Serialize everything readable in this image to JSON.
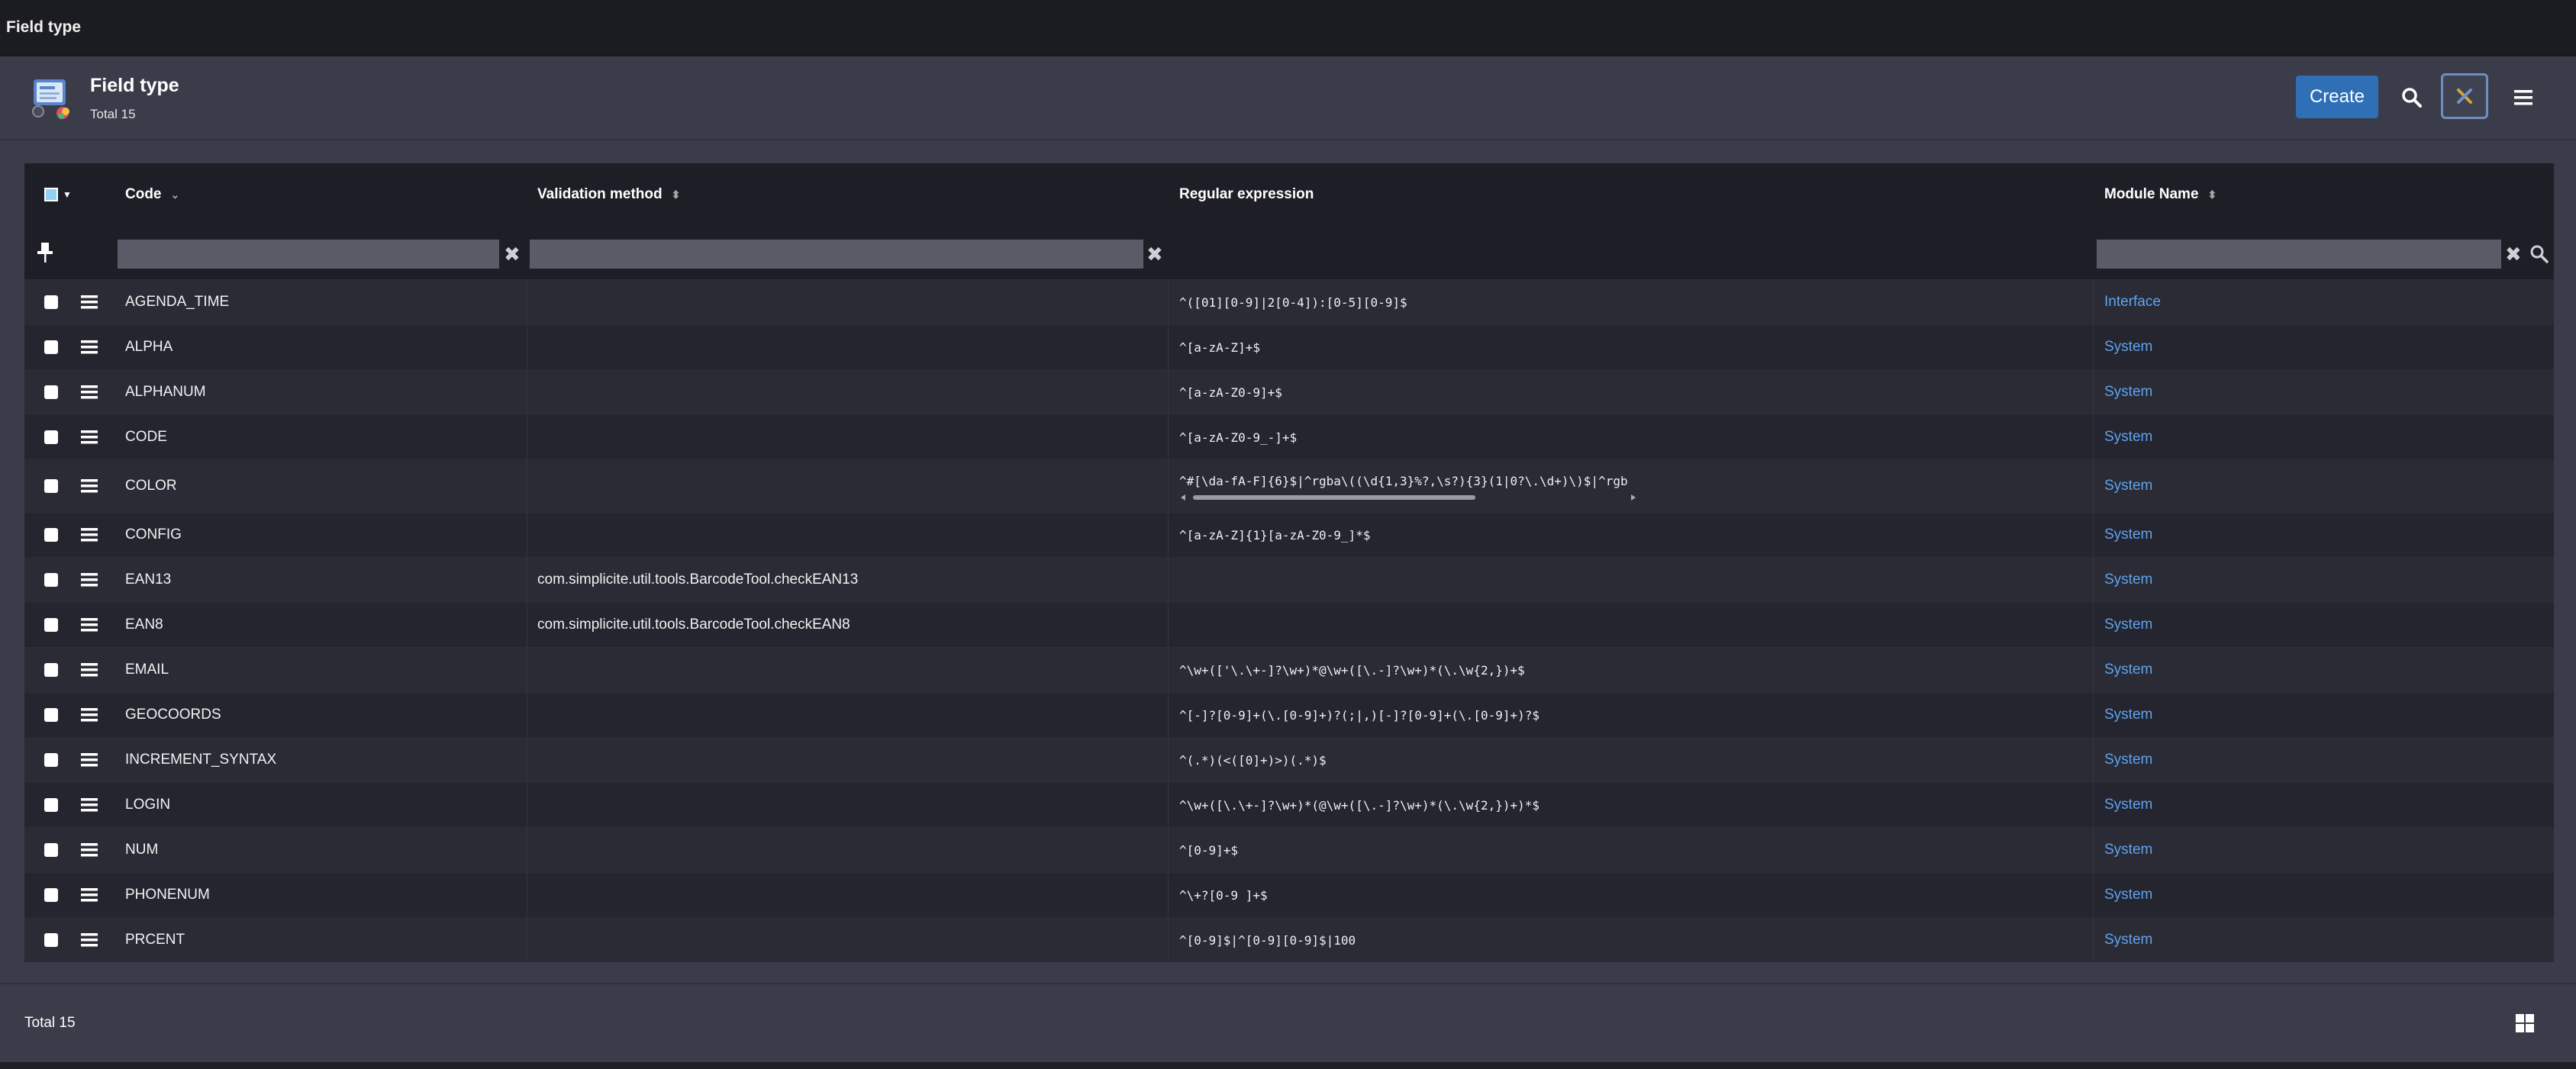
{
  "window": {
    "title": "Field type"
  },
  "header": {
    "title": "Field type",
    "subtitle": "Total 15",
    "create_label": "Create"
  },
  "columns": {
    "code": "Code",
    "validation": "Validation method",
    "regex": "Regular expression",
    "module": "Module Name"
  },
  "rows": [
    {
      "code": "AGENDA_TIME",
      "validation": "",
      "regex": "^([01][0-9]|2[0-4]):[0-5][0-9]$",
      "module": "Interface"
    },
    {
      "code": "ALPHA",
      "validation": "",
      "regex": "^[a-zA-Z]+$",
      "module": "System"
    },
    {
      "code": "ALPHANUM",
      "validation": "",
      "regex": "^[a-zA-Z0-9]+$",
      "module": "System"
    },
    {
      "code": "CODE",
      "validation": "",
      "regex": "^[a-zA-Z0-9_-]+$",
      "module": "System"
    },
    {
      "code": "COLOR",
      "validation": "",
      "regex": "^#[\\da-fA-F]{6}$|^rgba\\((\\d{1,3}%?,\\s?){3}(1|0?\\.\\d+)\\)$|^rgb",
      "module": "System"
    },
    {
      "code": "CONFIG",
      "validation": "",
      "regex": "^[a-zA-Z]{1}[a-zA-Z0-9_]*$",
      "module": "System"
    },
    {
      "code": "EAN13",
      "validation": "com.simplicite.util.tools.BarcodeTool.checkEAN13",
      "regex": "",
      "module": "System"
    },
    {
      "code": "EAN8",
      "validation": "com.simplicite.util.tools.BarcodeTool.checkEAN8",
      "regex": "",
      "module": "System"
    },
    {
      "code": "EMAIL",
      "validation": "",
      "regex": "^\\w+(['\\.\\+-]?\\w+)*@\\w+([\\.-]?\\w+)*(\\.\\w{2,})+$",
      "module": "System"
    },
    {
      "code": "GEOCOORDS",
      "validation": "",
      "regex": "^[-]?[0-9]+(\\.[0-9]+)?(;|,)[-]?[0-9]+(\\.[0-9]+)?$",
      "module": "System"
    },
    {
      "code": "INCREMENT_SYNTAX",
      "validation": "",
      "regex": "^(.*)(<([0]+)>)(.*)$",
      "module": "System"
    },
    {
      "code": "LOGIN",
      "validation": "",
      "regex": "^\\w+([\\.\\+-]?\\w+)*(@\\w+([\\.-]?\\w+)*(\\.\\w{2,})+)*$",
      "module": "System"
    },
    {
      "code": "NUM",
      "validation": "",
      "regex": "^[0-9]+$",
      "module": "System"
    },
    {
      "code": "PHONENUM",
      "validation": "",
      "regex": "^\\+?[0-9 ]+$",
      "module": "System"
    },
    {
      "code": "PRCENT",
      "validation": "",
      "regex": "^[0-9]$|^[0-9][0-9]$|100",
      "module": "System"
    }
  ],
  "footer": {
    "total": "Total 15"
  },
  "colors": {
    "accent": "#2e6fb6",
    "link": "#5fa3ee",
    "background": "#3b3c4a"
  }
}
